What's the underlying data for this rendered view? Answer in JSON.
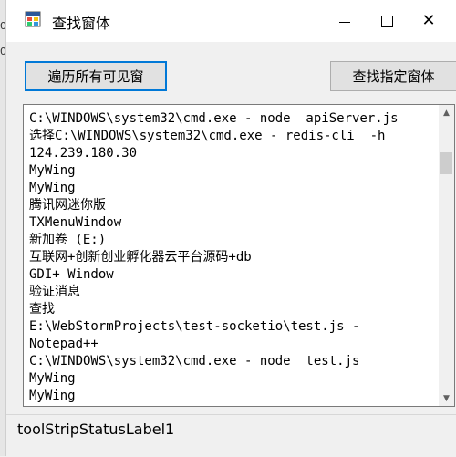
{
  "edge_fragments": [
    "0",
    "0"
  ],
  "window": {
    "title": "查找窗体",
    "icon": "app-window-icon",
    "controls": {
      "minimize": "minimize-icon",
      "maximize": "maximize-icon",
      "close": "close-icon"
    }
  },
  "toolbar": {
    "traverse_label": "遍历所有可见窗",
    "find_label": "查找指定窗体"
  },
  "list": {
    "lines": [
      "C:\\WINDOWS\\system32\\cmd.exe - node  apiServer.js",
      "选择C:\\WINDOWS\\system32\\cmd.exe - redis-cli  -h",
      "124.239.180.30",
      "MyWing",
      "MyWing",
      "腾讯网迷你版",
      "TXMenuWindow",
      "新加卷 (E:)",
      "互联网+创新创业孵化器云平台源码+db",
      "GDI+ Window",
      "验证消息",
      "查找",
      "E:\\WebStormProjects\\test-socketio\\test.js -",
      "Notepad++",
      "C:\\WINDOWS\\system32\\cmd.exe - node  test.js",
      "MyWing",
      "MyWing"
    ]
  },
  "status": {
    "label": "toolStripStatusLabel1"
  },
  "colors": {
    "focus_border": "#0078d7",
    "button_face": "#e1e1e1",
    "window_bg": "#f0f0f0"
  }
}
